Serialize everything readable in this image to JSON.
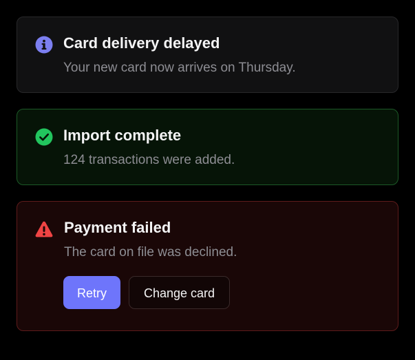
{
  "alerts": {
    "info": {
      "title": "Card delivery delayed",
      "message": "Your new card now arrives on Thursday.",
      "icon": "info-icon",
      "accent": "#7c7ff0"
    },
    "success": {
      "title": "Import complete",
      "message": "124 transactions were added.",
      "icon": "check-circle-icon",
      "accent": "#22c55e"
    },
    "error": {
      "title": "Payment failed",
      "message": "The card on file was declined.",
      "icon": "warning-triangle-icon",
      "accent": "#ef4444",
      "actions": {
        "retry_label": "Retry",
        "change_card_label": "Change card"
      }
    }
  },
  "colors": {
    "background": "#000000",
    "primary_button": "#6e75fb"
  }
}
